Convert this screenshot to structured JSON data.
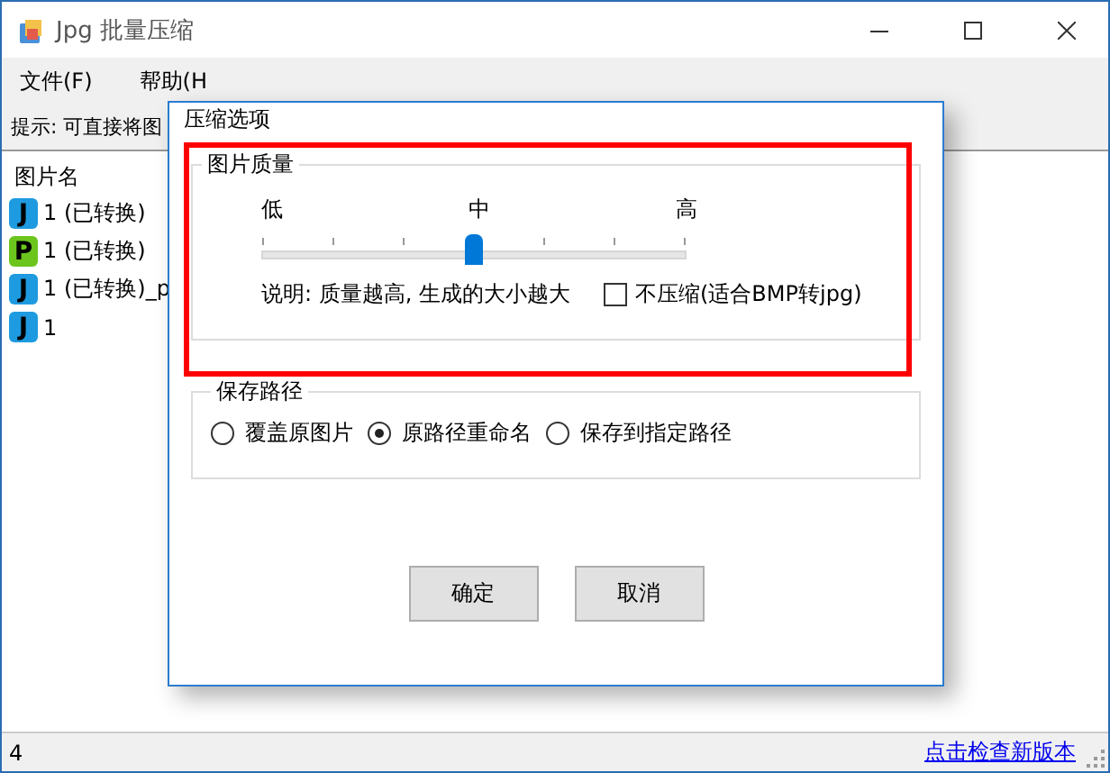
{
  "window": {
    "title": "Jpg 批量压缩"
  },
  "menu": [
    "文件(F)",
    "帮助(H"
  ],
  "hint": "提示: 可直接将图",
  "file_list": {
    "header": "图片名",
    "items": [
      {
        "badge": "J",
        "color": "#1e9be0",
        "name": "1 (已转换)"
      },
      {
        "badge": "P",
        "color": "#6cc51c",
        "name": "1 (已转换)"
      },
      {
        "badge": "J",
        "color": "#1e9be0",
        "name": "1 (已转换)_p"
      },
      {
        "badge": "J",
        "color": "#1e9be0",
        "name": "1"
      }
    ]
  },
  "dialog": {
    "title": "压缩选项",
    "quality": {
      "legend": "图片质量",
      "labels": [
        "低",
        "中",
        "高"
      ],
      "level": 0.5,
      "note": "说明: 质量越高, 生成的大小越大",
      "no_compress": {
        "label": "不压缩(适合BMP转jpg)",
        "checked": false
      }
    },
    "save_path": {
      "legend": "保存路径",
      "options": [
        {
          "label": "覆盖原图片",
          "selected": false
        },
        {
          "label": "原路径重命名",
          "selected": true
        },
        {
          "label": "保存到指定路径",
          "selected": false
        }
      ]
    },
    "buttons": [
      "确定",
      "取消"
    ]
  },
  "status_bar": {
    "count": "4",
    "link": "点击检查新版本"
  }
}
